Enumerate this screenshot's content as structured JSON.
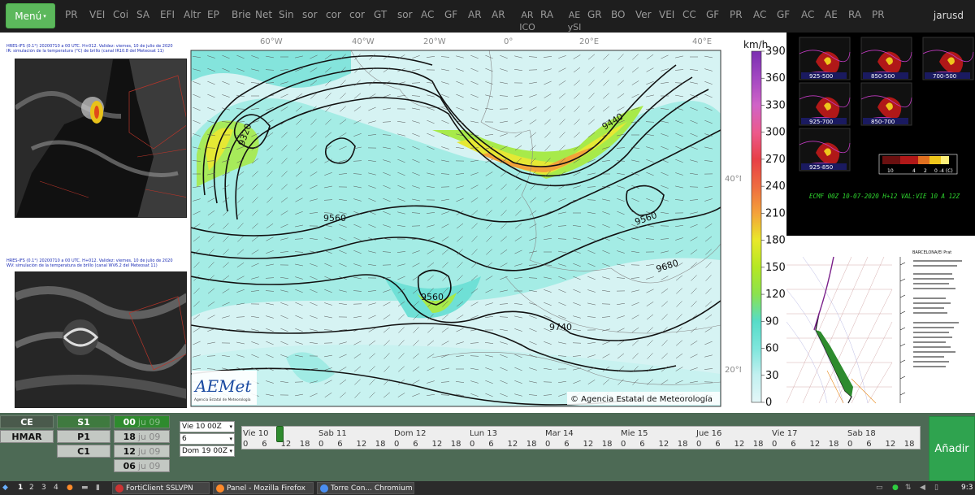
{
  "topbar": {
    "menu_label": "Menú",
    "items": [
      "PR",
      "VEI",
      "Coi",
      "SA",
      "EFI",
      "Altr",
      "EP",
      "Brie",
      "Net",
      "Sin",
      "sor",
      "cor",
      "cor",
      "GT",
      "sor",
      "AC",
      "GF",
      "AR",
      "AR",
      "AR\nICO",
      "RA",
      "AE\nySI",
      "GR",
      "BO",
      "Ver",
      "VEI",
      "CC",
      "GF",
      "PR",
      "AC",
      "GF",
      "AC",
      "AE",
      "RA",
      "PR"
    ],
    "user": "jarusd"
  },
  "left_panels": {
    "top_caption_1": "HRES-IFS (0.1°) 20200710 a 00 UTC.  H+012. Validez: viernes, 10 de julio de 2020",
    "top_caption_2": "IR: simulación de la temperatura (°C) de brillo (canal IR10.8 del Meteosat 11)",
    "bottom_caption_1": "HRES-IFS (0.1°) 20200710 a 00 UTC.  H+012. Validez: viernes, 10 de julio de 2020",
    "bottom_caption_2": "WV: simulación de la temperatura de brillo (canal WV6.2 del Meteosat 11)"
  },
  "main_map": {
    "lon_labels": [
      "60°W",
      "40°W",
      "20°W",
      "0°",
      "20°E",
      "40°E"
    ],
    "lat_labels": [
      "40°N",
      "20°N"
    ],
    "contour_labels": [
      "9320",
      "9440",
      "9560",
      "9560",
      "9560",
      "9680",
      "9740"
    ],
    "logo_text": "AEMet",
    "logo_subtext": "Agencia Estatal de Meteorología",
    "copyright": "© Agencia Estatal de Meteorología"
  },
  "colorbar": {
    "unit": "km/h",
    "ticks": [
      "390",
      "360",
      "330",
      "300",
      "270",
      "240",
      "210",
      "180",
      "150",
      "120",
      "90",
      "60",
      "30",
      "0"
    ]
  },
  "right_panels": {
    "rp1_tiles": [
      "925-500",
      "850-500",
      "700-500",
      "925-700",
      "850-700",
      "925-850"
    ],
    "rp1_scale": [
      "10",
      "4",
      "2",
      "0",
      "-4 (C)"
    ],
    "rp1_caption": "ECMF 00Z 10-07-2020 H+12 VAL:VIE 10 A 12Z",
    "rp2_station": "BARCELONA/El Prat"
  },
  "bottom": {
    "col1": [
      "CE",
      "HMAR"
    ],
    "col2": [
      "S1",
      "P1",
      "C1"
    ],
    "col3": [
      {
        "day": "00",
        "month": "ju 09",
        "active": true
      },
      {
        "day": "18",
        "month": "ju 09",
        "active": false
      },
      {
        "day": "12",
        "month": "ju 09",
        "active": false
      },
      {
        "day": "06",
        "month": "ju 09",
        "active": false
      }
    ],
    "select_start": "Vie 10 00Z",
    "select_step": "6",
    "select_end": "Dom 19 00Z",
    "timeline_days": [
      "Vie 10",
      "Sab 11",
      "Dom 12",
      "Lun 13",
      "Mar 14",
      "Mie 15",
      "Jue 16",
      "Vie 17",
      "Sab 18"
    ],
    "timeline_hours": [
      "0",
      "6",
      "12",
      "18"
    ],
    "slider_value": "12",
    "add_label": "Añadir"
  },
  "taskbar": {
    "workspaces": [
      "1",
      "2",
      "3",
      "4"
    ],
    "tasks": [
      "FortiClient SSLVPN",
      "Panel - Mozilla Firefox",
      "Torre Con... Chromium"
    ],
    "clock": "9:3"
  },
  "colors": {
    "topbar_bg": "#1e1e1e",
    "menu_green": "#5cb85c",
    "bottom_bg": "#4d6a55",
    "add_green": "#2fa34f",
    "map_wind_cyan": "#6fe0d6",
    "map_wind_yellow": "#e5e834"
  }
}
